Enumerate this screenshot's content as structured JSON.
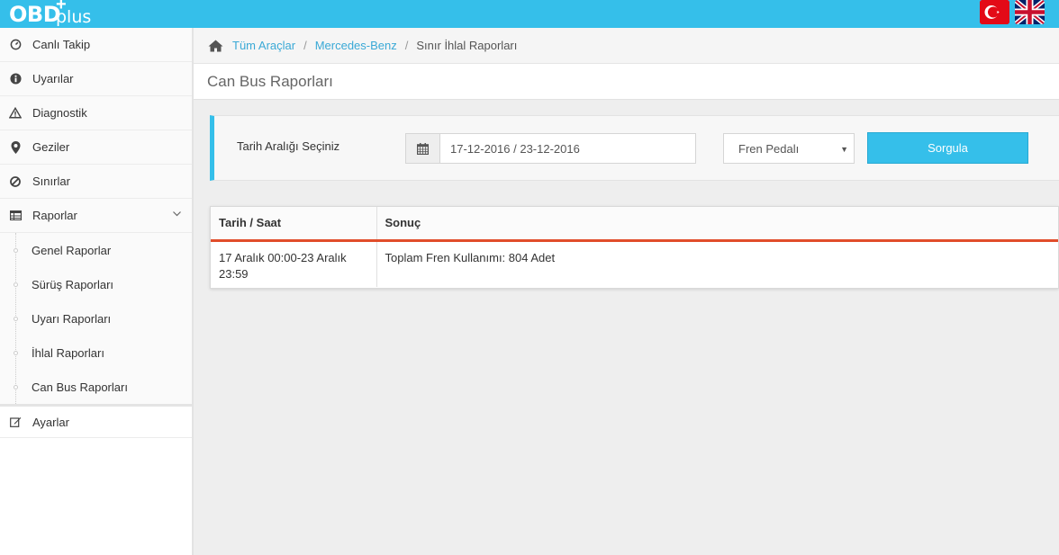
{
  "brand": {
    "logo_main": "OBD",
    "logo_plus_sign": "+",
    "logo_plus_word": "plus",
    "color": "#35bfea"
  },
  "languages": [
    {
      "name": "turkish-flag-icon"
    },
    {
      "name": "english-flag-icon"
    }
  ],
  "sidebar": {
    "items": [
      {
        "label": "Canlı Takip",
        "icon": "speedometer-icon"
      },
      {
        "label": "Uyarılar",
        "icon": "info-circle-icon"
      },
      {
        "label": "Diagnostik",
        "icon": "warning-triangle-icon"
      },
      {
        "label": "Geziler",
        "icon": "map-marker-icon"
      },
      {
        "label": "Sınırlar",
        "icon": "ban-icon"
      },
      {
        "label": "Raporlar",
        "icon": "table-icon",
        "expanded": true
      }
    ],
    "sub_items": [
      {
        "label": "Genel Raporlar"
      },
      {
        "label": "Sürüş Raporları"
      },
      {
        "label": "Uyarı Raporları"
      },
      {
        "label": "İhlal Raporları"
      },
      {
        "label": "Can Bus Raporları"
      }
    ],
    "settings": {
      "label": "Ayarlar",
      "icon": "edit-icon"
    }
  },
  "breadcrumb": {
    "items": [
      {
        "label": "Tüm Araçlar"
      },
      {
        "label": "Mercedes-Benz"
      }
    ],
    "separator": "/",
    "current": "Sınır İhlal Raporları"
  },
  "page": {
    "title": "Can Bus Raporları"
  },
  "filter": {
    "label": "Tarih Aralığı Seçiniz",
    "date_range": "17-12-2016 / 23-12-2016",
    "select_value": "Fren Pedalı",
    "submit_label": "Sorgula"
  },
  "results": {
    "headers": [
      "Tarih / Saat",
      "Sonuç"
    ],
    "rows": [
      [
        "17 Aralık 00:00-23 Aralık 23:59",
        "Toplam Fren Kullanımı: 804 Adet"
      ]
    ],
    "header_accent": "#e14d2a"
  }
}
